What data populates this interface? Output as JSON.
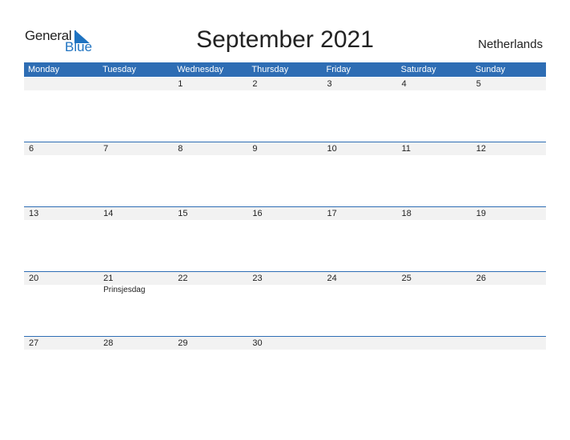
{
  "logo": {
    "general": "General",
    "blue": "Blue"
  },
  "title": "September 2021",
  "country": "Netherlands",
  "colors": {
    "accent": "#2E6DB4",
    "strip": "#F2F2F2",
    "logo_blue": "#1F73C1"
  },
  "weekdays": [
    "Monday",
    "Tuesday",
    "Wednesday",
    "Thursday",
    "Friday",
    "Saturday",
    "Sunday"
  ],
  "weeks": [
    [
      {
        "day": ""
      },
      {
        "day": ""
      },
      {
        "day": "1"
      },
      {
        "day": "2"
      },
      {
        "day": "3"
      },
      {
        "day": "4"
      },
      {
        "day": "5"
      }
    ],
    [
      {
        "day": "6"
      },
      {
        "day": "7"
      },
      {
        "day": "8"
      },
      {
        "day": "9"
      },
      {
        "day": "10"
      },
      {
        "day": "11"
      },
      {
        "day": "12"
      }
    ],
    [
      {
        "day": "13"
      },
      {
        "day": "14"
      },
      {
        "day": "15"
      },
      {
        "day": "16"
      },
      {
        "day": "17"
      },
      {
        "day": "18"
      },
      {
        "day": "19"
      }
    ],
    [
      {
        "day": "20"
      },
      {
        "day": "21",
        "holiday": "Prinsjesdag"
      },
      {
        "day": "22"
      },
      {
        "day": "23"
      },
      {
        "day": "24"
      },
      {
        "day": "25"
      },
      {
        "day": "26"
      }
    ],
    [
      {
        "day": "27"
      },
      {
        "day": "28"
      },
      {
        "day": "29"
      },
      {
        "day": "30"
      },
      {
        "day": ""
      },
      {
        "day": ""
      },
      {
        "day": ""
      }
    ]
  ]
}
